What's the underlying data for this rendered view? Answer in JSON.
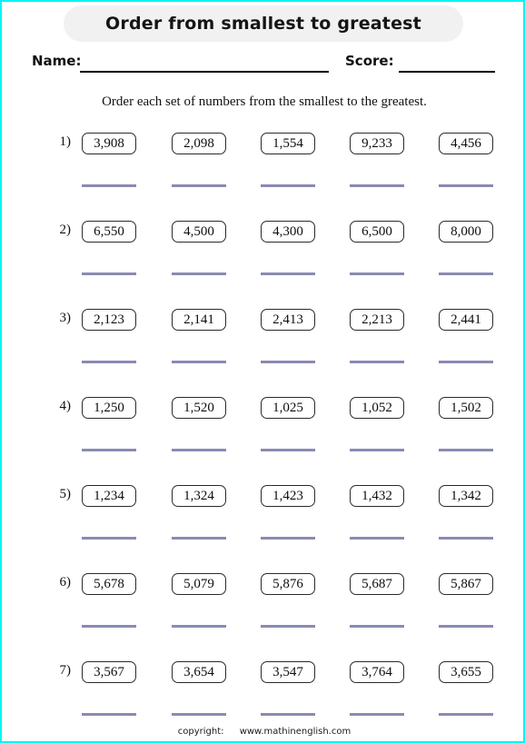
{
  "worksheet": {
    "title": "Order from smallest to greatest",
    "instruction": "Order each set of numbers from the smallest to the greatest.",
    "border_color": "#00f5f5",
    "banner_color": "#f1f1f1",
    "answer_line_color": "#8a8ab4"
  },
  "header": {
    "name_label": "Name:",
    "score_label": "Score:"
  },
  "footer": {
    "copyright_label": "copyright:",
    "site": "www.mathinenglish.com"
  },
  "problems": [
    {
      "index": "1)",
      "numbers": [
        "3,908",
        "2,098",
        "1,554",
        "9,233",
        "4,456"
      ]
    },
    {
      "index": "2)",
      "numbers": [
        "6,550",
        "4,500",
        "4,300",
        "6,500",
        "8,000"
      ]
    },
    {
      "index": "3)",
      "numbers": [
        "2,123",
        "2,141",
        "2,413",
        "2,213",
        "2,441"
      ]
    },
    {
      "index": "4)",
      "numbers": [
        "1,250",
        "1,520",
        "1,025",
        "1,052",
        "1,502"
      ]
    },
    {
      "index": "5)",
      "numbers": [
        "1,234",
        "1,324",
        "1,423",
        "1,432",
        "1,342"
      ]
    },
    {
      "index": "6)",
      "numbers": [
        "5,678",
        "5,079",
        "5,876",
        "5,687",
        "5,867"
      ]
    },
    {
      "index": "7)",
      "numbers": [
        "3,567",
        "3,654",
        "3,547",
        "3,764",
        "3,655"
      ]
    }
  ]
}
